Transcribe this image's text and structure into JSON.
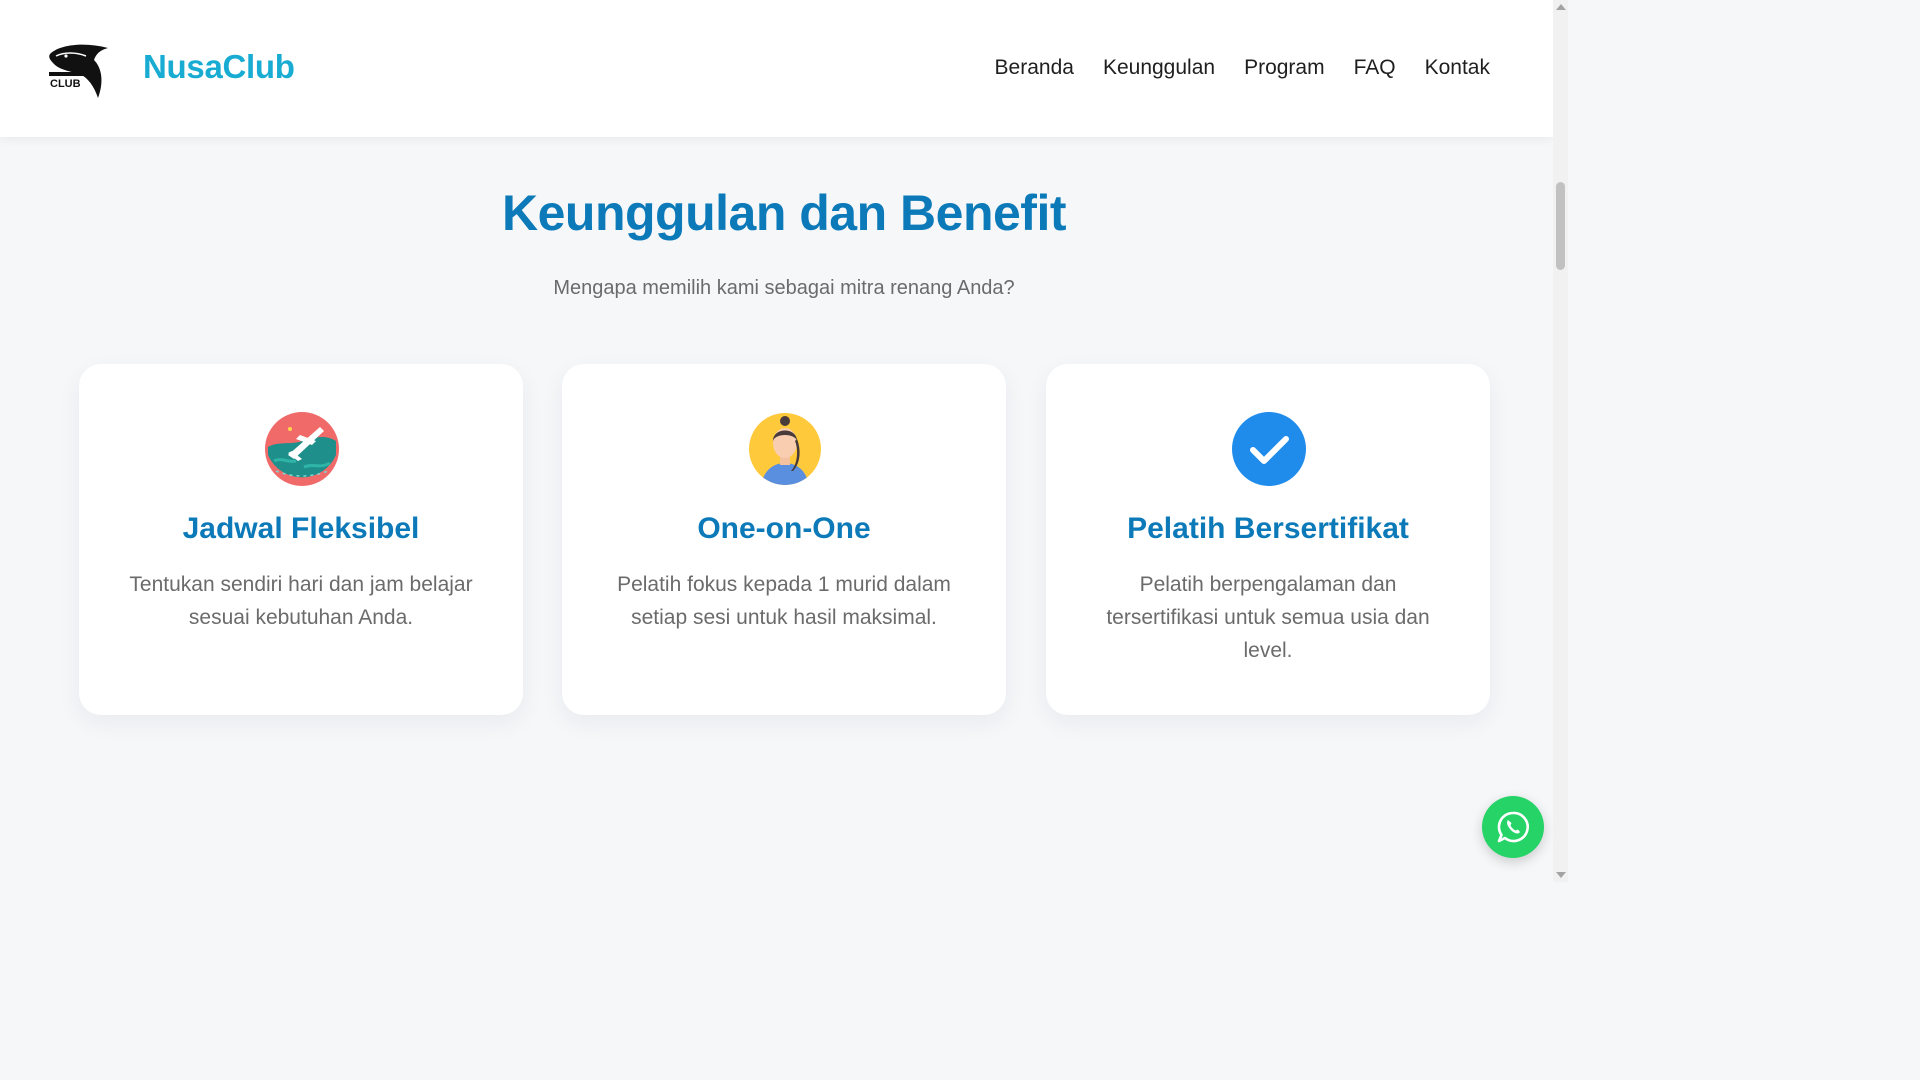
{
  "header": {
    "brand": "NusaClub",
    "logo_icon": "dolphin-logo",
    "nav": [
      "Beranda",
      "Keunggulan",
      "Program",
      "FAQ",
      "Kontak"
    ]
  },
  "section": {
    "title": "Keunggulan dan Benefit",
    "subtitle": "Mengapa memilih kami sebagai mitra renang Anda?"
  },
  "cards": [
    {
      "icon": "globe-airplane-icon",
      "title": "Jadwal Fleksibel",
      "description": "Tentukan sendiri hari dan jam belajar sesuai kebutuhan Anda."
    },
    {
      "icon": "coach-avatar-icon",
      "title": "One-on-One",
      "description": "Pelatih fokus kepada 1 murid dalam setiap sesi untuk hasil maksimal."
    },
    {
      "icon": "check-circle-icon",
      "title": "Pelatih Bersertifikat",
      "description": "Pelatih berpengalaman dan tersertifikasi untuk semua usia dan level."
    }
  ],
  "floating": {
    "whatsapp_icon": "whatsapp-icon",
    "color": "#25d366"
  },
  "colors": {
    "brand": "#19acd3",
    "heading": "#0c7ab8",
    "background": "#f6f7f9"
  }
}
